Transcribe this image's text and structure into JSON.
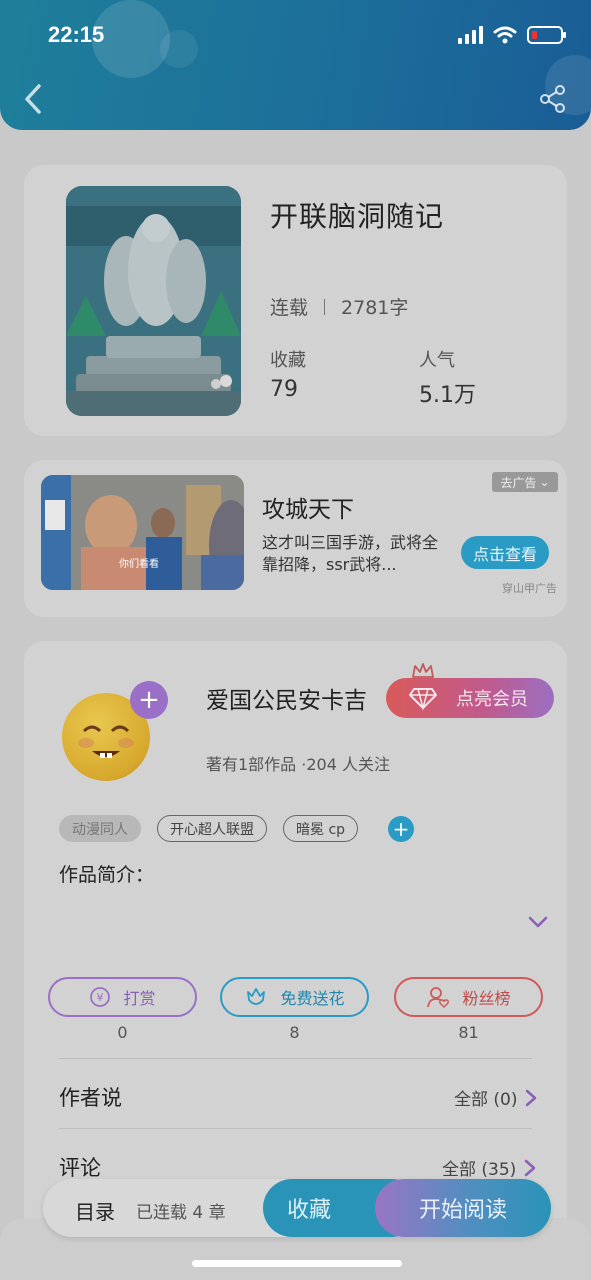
{
  "status_bar": {
    "time": "22:15"
  },
  "book": {
    "title": "开联脑洞随记",
    "status": "连载",
    "word_count": "2781字",
    "favorites_label": "收藏",
    "favorites_value": "79",
    "popularity_label": "人气",
    "popularity_value": "5.1万"
  },
  "ad": {
    "title": "攻城天下",
    "description": "这才叫三国手游，武将全靠招降，ssr武将...",
    "button": "点击查看",
    "tag": "去广告",
    "source": "穿山甲广告",
    "image_caption": "你们看看"
  },
  "author": {
    "name": "爱国公民安卡吉",
    "member_button": "点亮会员",
    "meta": "著有1部作品 ·204 人关注",
    "tags": [
      "动漫同人",
      "开心超人联盟",
      "暗冕 cp"
    ],
    "intro_label": "作品简介："
  },
  "actions": [
    {
      "label": "打赏",
      "count": "0",
      "color": "#9a6fc7"
    },
    {
      "label": "免费送花",
      "count": "8",
      "color": "#2a9bc4"
    },
    {
      "label": "粉丝榜",
      "count": "81",
      "color": "#d05a5a"
    }
  ],
  "author_says": {
    "label": "作者说",
    "link": "全部 (0)"
  },
  "comments": {
    "label": "评论",
    "link": "全部 (35)"
  },
  "bottom_bar": {
    "toc": "目录",
    "chapters": "已连载 4 章",
    "favorite": "收藏",
    "read": "开始阅读"
  },
  "icons": [
    "back-icon",
    "share-icon",
    "plus-icon",
    "crown-icon",
    "diamond-icon",
    "chevron-down-icon",
    "chevron-right-icon",
    "yuan-icon",
    "flower-icon",
    "fans-icon"
  ]
}
